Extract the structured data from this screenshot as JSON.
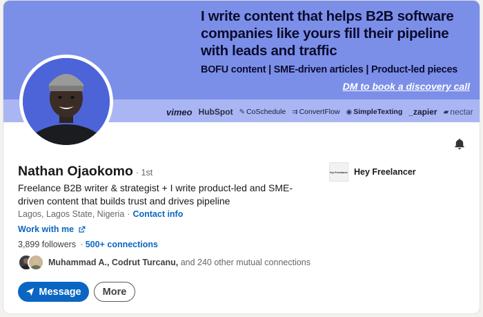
{
  "banner": {
    "headline": "I write content that helps B2B software companies like yours fill their pipeline with leads and traffic",
    "subline": "BOFU content | SME-driven articles | Product-led pieces",
    "cta": "DM to book a discovery call",
    "logos": [
      {
        "text": "vimeo",
        "icon": null
      },
      {
        "text": "HubSpot",
        "icon": null
      },
      {
        "text": "CoSchedule",
        "icon": "coschedule-icon"
      },
      {
        "text": "ConvertFlow",
        "icon": "convertflow-icon"
      },
      {
        "text": "SimpleTexting",
        "icon": "simpletexting-icon"
      },
      {
        "text": "_zapier",
        "icon": null
      },
      {
        "text": "nectar",
        "icon": "nectar-icon"
      }
    ]
  },
  "profile": {
    "name": "Nathan Ojaokomo",
    "degree": "· 1st",
    "headline": "Freelance B2B writer & strategist + I write product-led and SME-driven content that builds trust and drives pipeline",
    "location": "Lagos, Lagos State, Nigeria",
    "location_sep": "·",
    "contact_info": "Contact info",
    "work_with_me": "Work with me",
    "followers": "3,899 followers",
    "followers_sep": "·",
    "connections": "500+ connections",
    "mutual_names": "Muhammad A., Codrut Turcanu,",
    "mutual_rest": "and 240 other mutual connections"
  },
  "company": {
    "logo_text": "Hey Freelancer",
    "name": "Hey Freelancer"
  },
  "actions": {
    "message": "Message",
    "more": "More"
  },
  "colors": {
    "banner": "#7b8fe8",
    "banner_strip": "#aab6f3",
    "link": "#0a66c2",
    "primary_button": "#0a66c2"
  }
}
